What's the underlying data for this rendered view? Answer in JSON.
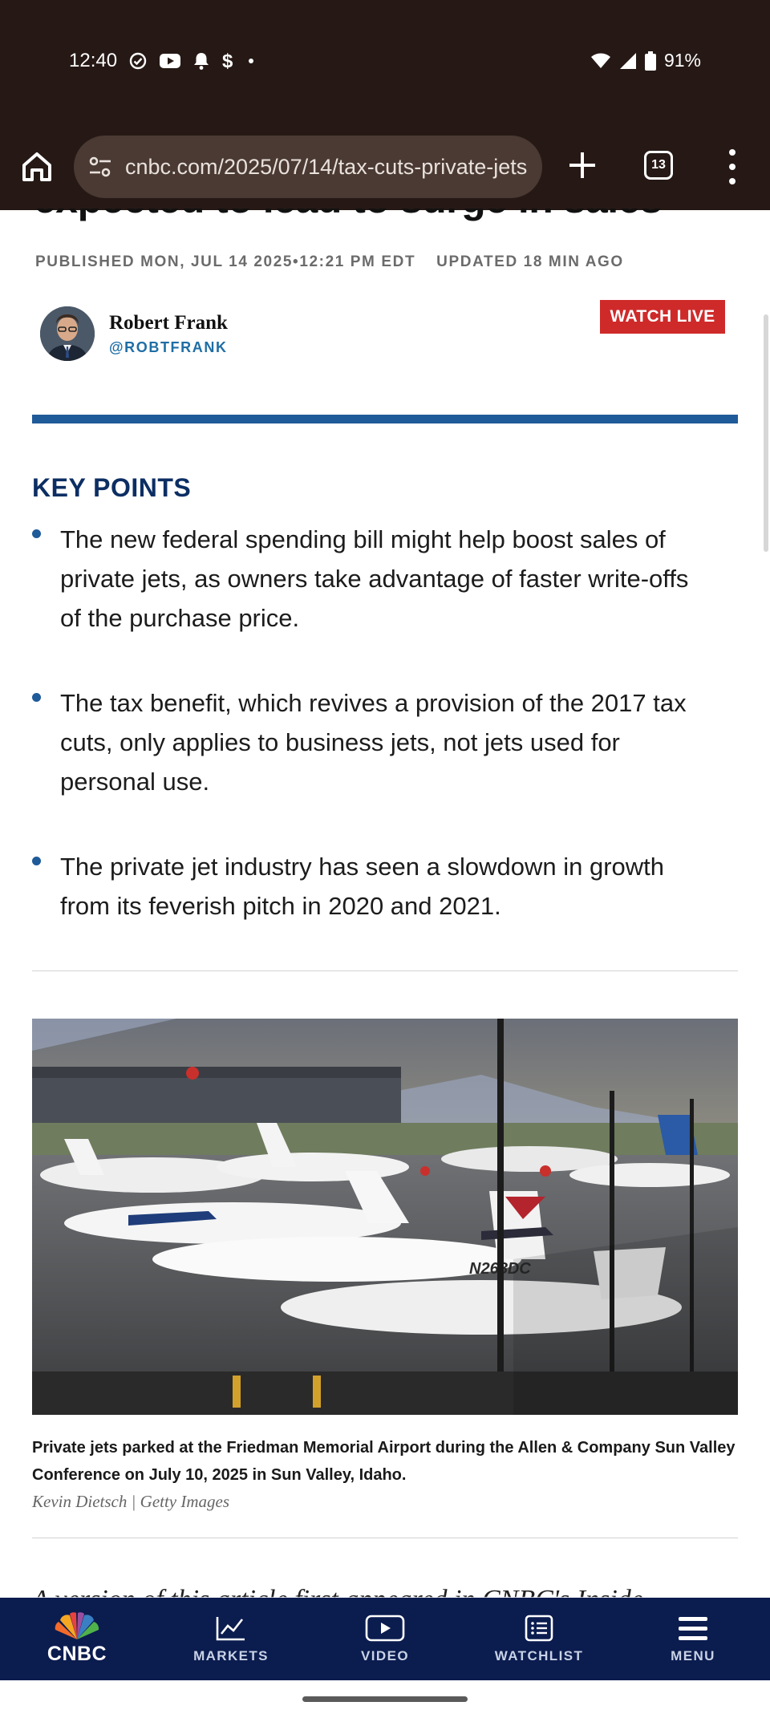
{
  "status_bar": {
    "time": "12:40",
    "battery": "91%"
  },
  "browser": {
    "url": "cnbc.com/2025/07/14/tax-cuts-private-jets",
    "tab_count": "13"
  },
  "article": {
    "headline_fragment": "expected to lead to surge in sales",
    "published": "PUBLISHED MON, JUL 14 2025•12:21 PM EDT",
    "updated": "UPDATED 18 MIN AGO",
    "author": {
      "name": "Robert Frank",
      "handle": "@ROBTFRANK"
    },
    "watch_live": "WATCH LIVE",
    "key_points": {
      "title": "KEY POINTS",
      "items": [
        "The new federal spending bill might help boost sales of private jets, as owners take advantage of faster write-offs of the purchase price.",
        "The tax benefit, which revives a provision of the 2017 tax cuts, only applies to business jets, not jets used for personal use.",
        "The private jet industry has seen a slowdown in growth from its feverish pitch in 2020 and 2021."
      ]
    },
    "photo": {
      "caption": "Private jets parked at the Friedman Memorial Airport during the Allen & Company Sun Valley Conference on July 10, 2025 in Sun Valley, Idaho.",
      "credit": "Kevin Dietsch | Getty Images",
      "plane_tail_text": "N268DC"
    },
    "teaser": "A version of this article first appeared in CNBC's Inside"
  },
  "bottom_nav": {
    "logo": "CNBC",
    "items": [
      "MARKETS",
      "VIDEO",
      "WATCHLIST",
      "MENU"
    ]
  },
  "colors": {
    "chrome_bg": "#261915",
    "url_bar_bg": "#4a3a33",
    "accent_blue": "#1f5a99",
    "key_points_title": "#0c2e63",
    "watch_live_red": "#cf2a2a",
    "nav_bg": "#0b1c4f"
  }
}
